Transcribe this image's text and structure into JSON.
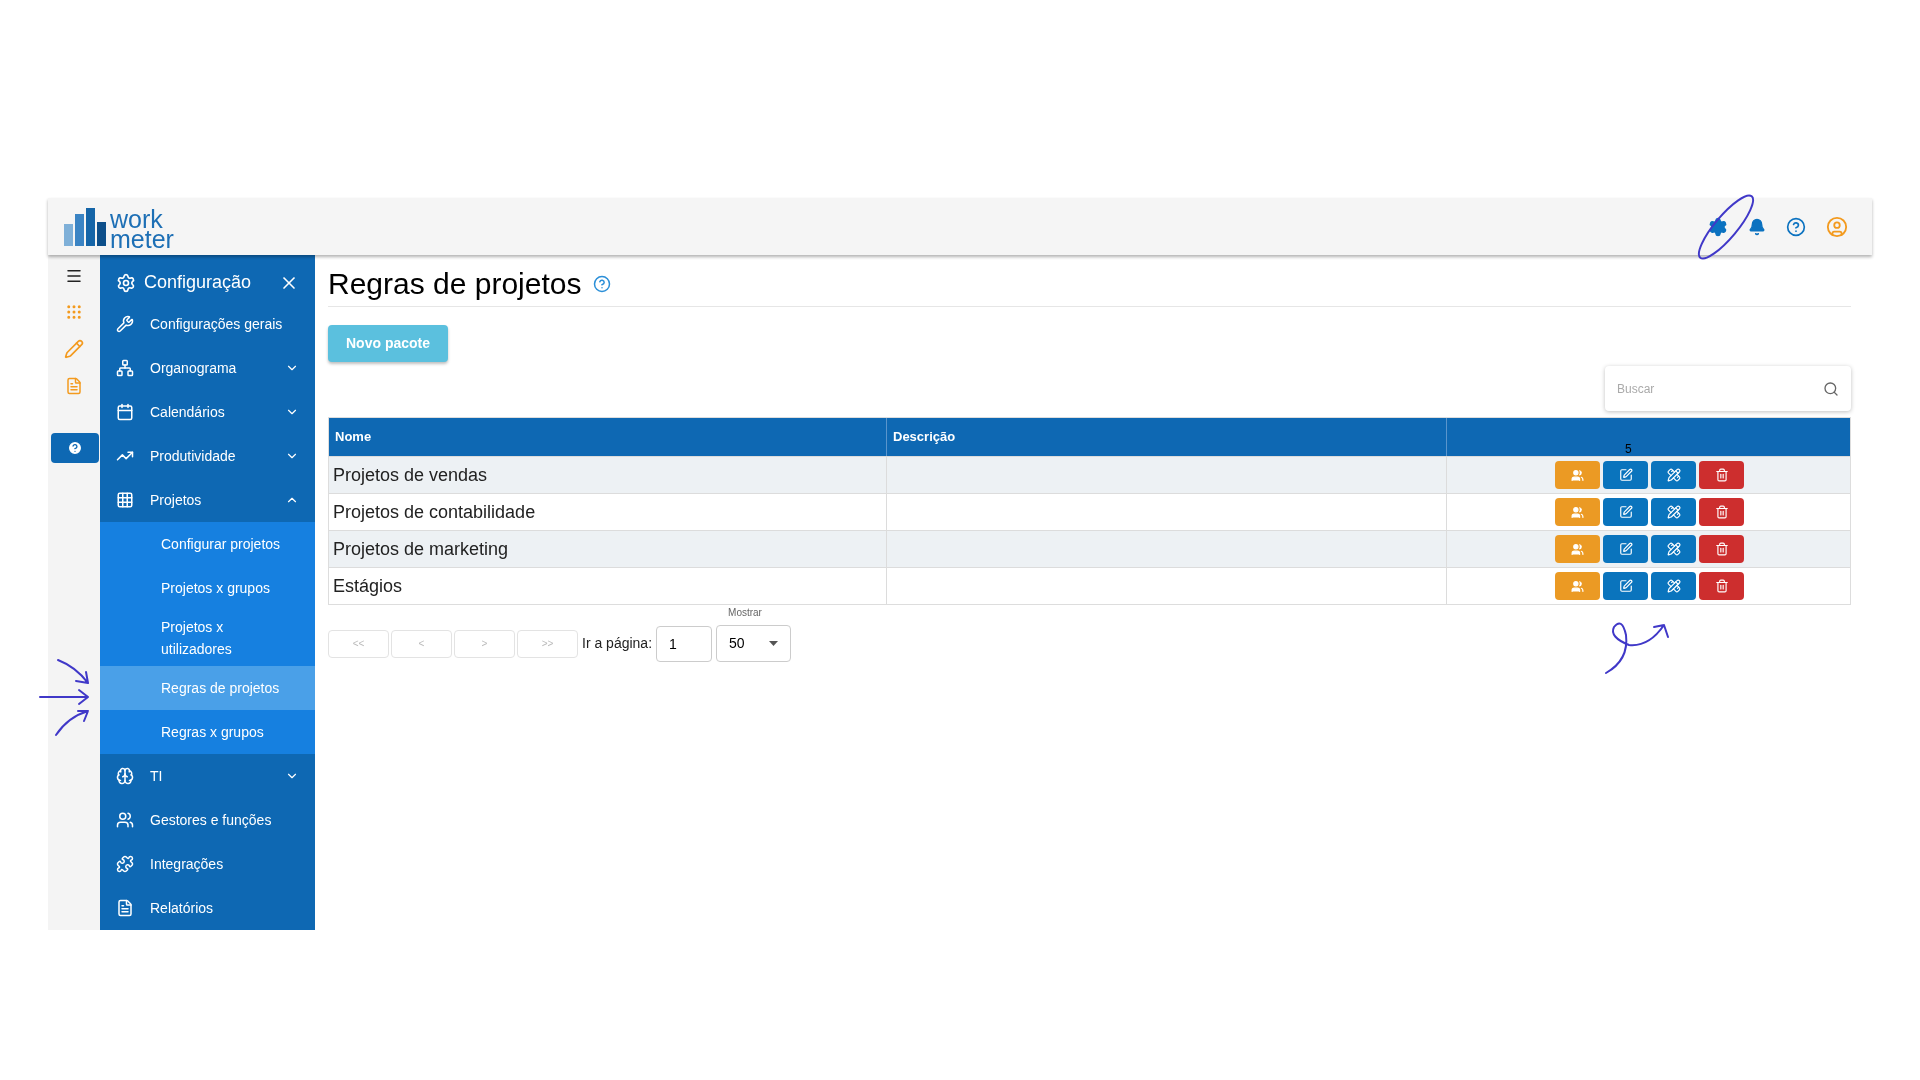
{
  "logo": {
    "line_1": "work",
    "line_2": "meter"
  },
  "sidebar": {
    "title": "Configuração",
    "items": [
      {
        "label": "Configurações gerais"
      },
      {
        "label": "Organograma",
        "expanded": false
      },
      {
        "label": "Calendários",
        "expanded": false
      },
      {
        "label": "Produtividade",
        "expanded": false
      },
      {
        "label": "Projetos",
        "expanded": true,
        "children": [
          {
            "label": "Configurar projetos",
            "selected": false
          },
          {
            "label": "Projetos x grupos",
            "selected": false
          },
          {
            "label": "Projetos x utilizadores",
            "selected": false
          },
          {
            "label": "Regras de projetos",
            "selected": true
          },
          {
            "label": "Regras x grupos",
            "selected": false
          }
        ]
      },
      {
        "label": "TI",
        "expanded": false
      },
      {
        "label": "Gestores e funções"
      },
      {
        "label": "Integrações"
      },
      {
        "label": "Relatórios"
      }
    ]
  },
  "page": {
    "title": "Regras de projetos",
    "new_button": "Novo pacote",
    "search": {
      "placeholder": "Buscar"
    }
  },
  "table": {
    "columns": [
      "Nome",
      "Descrição"
    ],
    "rows": [
      {
        "name": "Projetos de vendas"
      },
      {
        "name": "Projetos de contabilidade"
      },
      {
        "name": "Projetos de marketing"
      },
      {
        "name": "Estágios"
      }
    ],
    "stray_label": "5"
  },
  "pagination": {
    "buttons": [
      "<<",
      "<",
      ">",
      ">>"
    ],
    "goto_label": "Ir a página:",
    "page_value": "1",
    "show_label": "Mostrar",
    "show_value": "50"
  }
}
